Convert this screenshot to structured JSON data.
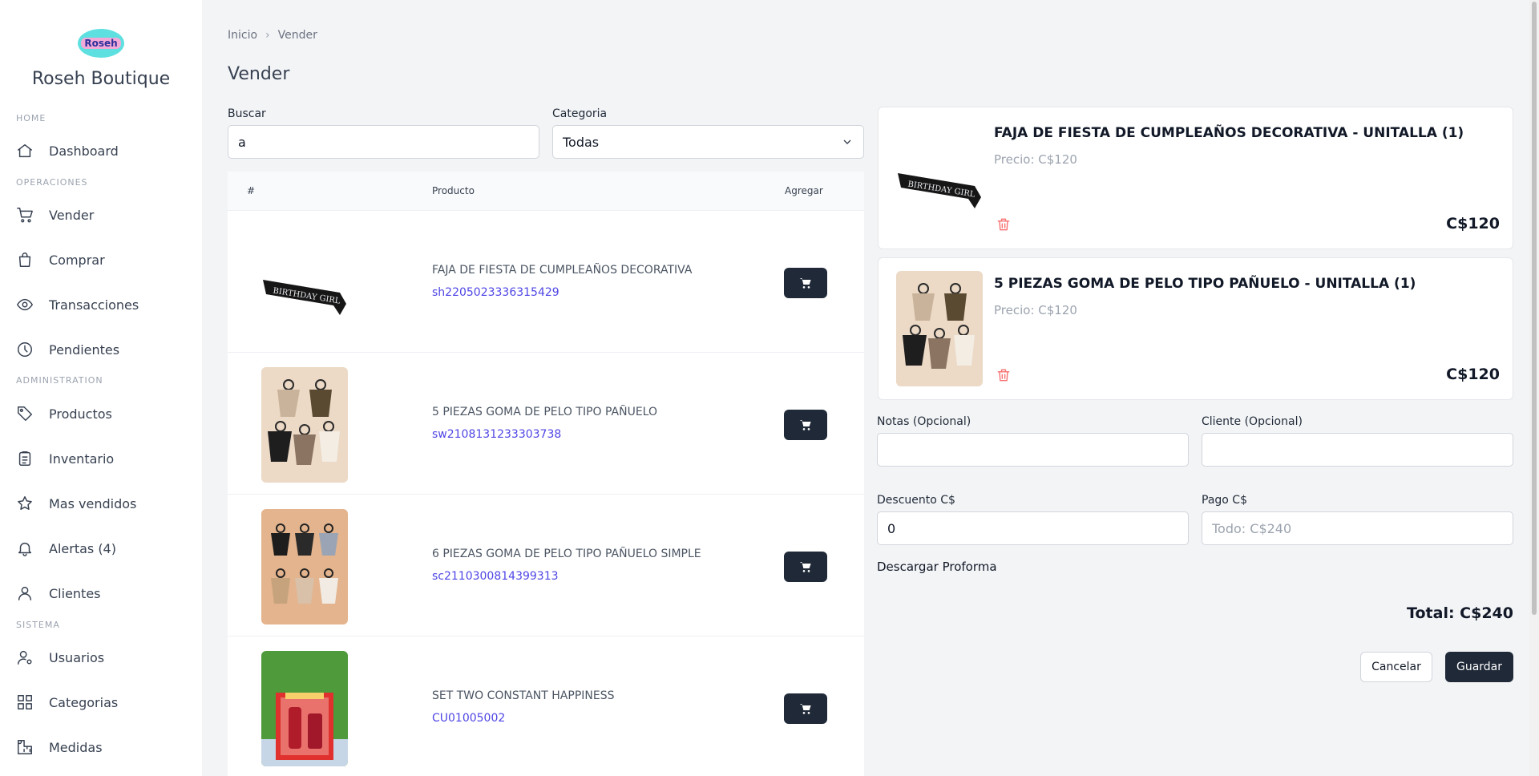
{
  "brand": {
    "logo_text": "Roseh",
    "name": "Roseh Boutique"
  },
  "sidebar": {
    "sections": [
      "HOME",
      "OPERACIONES",
      "ADMINISTRATION",
      "SISTEMA"
    ],
    "items": [
      {
        "label": "Dashboard",
        "icon": "home-icon"
      },
      {
        "label": "Vender",
        "icon": "cart-icon"
      },
      {
        "label": "Comprar",
        "icon": "shopping-bag-icon"
      },
      {
        "label": "Transacciones",
        "icon": "eye-icon"
      },
      {
        "label": "Pendientes",
        "icon": "clock-icon"
      },
      {
        "label": "Productos",
        "icon": "tag-icon"
      },
      {
        "label": "Inventario",
        "icon": "clipboard-icon"
      },
      {
        "label": "Mas vendidos",
        "icon": "star-icon"
      },
      {
        "label": "Alertas (4)",
        "icon": "bell-icon"
      },
      {
        "label": "Clientes",
        "icon": "user-icon"
      },
      {
        "label": "Usuarios",
        "icon": "user-cog-icon"
      },
      {
        "label": "Categorias",
        "icon": "grid-icon"
      },
      {
        "label": "Medidas",
        "icon": "ruler-icon"
      }
    ]
  },
  "breadcrumb": {
    "home": "Inicio",
    "current": "Vender"
  },
  "page_title": "Vender",
  "filters": {
    "search_label": "Buscar",
    "search_value": "a",
    "category_label": "Categoria",
    "category_value": "Todas"
  },
  "table": {
    "headers": {
      "num": "#",
      "product": "Producto",
      "add": "Agregar"
    },
    "rows": [
      {
        "name": "FAJA DE FIESTA DE CUMPLEAÑOS DECORATIVA",
        "code": "sh2205023336315429"
      },
      {
        "name": "5 PIEZAS GOMA DE PELO TIPO PAÑUELO",
        "code": "sw2108131233303738"
      },
      {
        "name": "6 PIEZAS GOMA DE PELO TIPO PAÑUELO SIMPLE",
        "code": "sc2110300814399313"
      },
      {
        "name": "SET TWO CONSTANT HAPPINESS",
        "code": "CU01005002"
      }
    ]
  },
  "cart": {
    "items": [
      {
        "name": "FAJA DE FIESTA DE CUMPLEAÑOS DECORATIVA - UNITALLA (1)",
        "price": "Precio: C$120",
        "total": "C$120"
      },
      {
        "name": "5 PIEZAS GOMA DE PELO TIPO PAÑUELO - UNITALLA (1)",
        "price": "Precio: C$120",
        "total": "C$120"
      }
    ],
    "notes_label": "Notas (Opcional)",
    "notes_value": "",
    "client_label": "Cliente (Opcional)",
    "client_value": "",
    "discount_label": "Descuento C$",
    "discount_value": "0",
    "payment_label": "Pago C$",
    "payment_placeholder": "Todo: C$240",
    "download_label": "Descargar Proforma",
    "total_label": "Total: C$240",
    "cancel_label": "Cancelar",
    "save_label": "Guardar"
  },
  "colors": {
    "primary": "#1f2937",
    "link": "#4f46e5",
    "danger": "#f87171",
    "background": "#f3f4f6"
  }
}
